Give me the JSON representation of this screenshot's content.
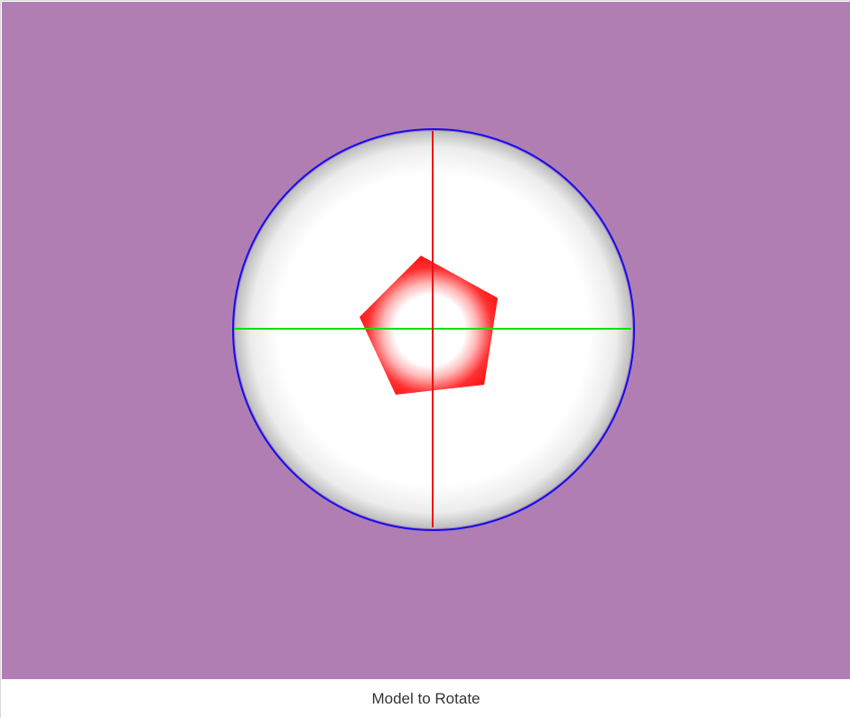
{
  "caption": {
    "label": "Model to Rotate"
  },
  "colors": {
    "background": "#b07eb2",
    "sphere_outline": "#1010ee",
    "sphere_fill": "#ffffff",
    "sphere_shade": "#c9c9c9",
    "vertical_axis": "#ee1111",
    "horizontal_axis": "#11dd11",
    "pentagon": "#ff1a1a",
    "caption_text": "#333333"
  },
  "icons": {
    "sphere": "trackball-sphere-icon",
    "pentagon": "pentagon-model-icon"
  }
}
